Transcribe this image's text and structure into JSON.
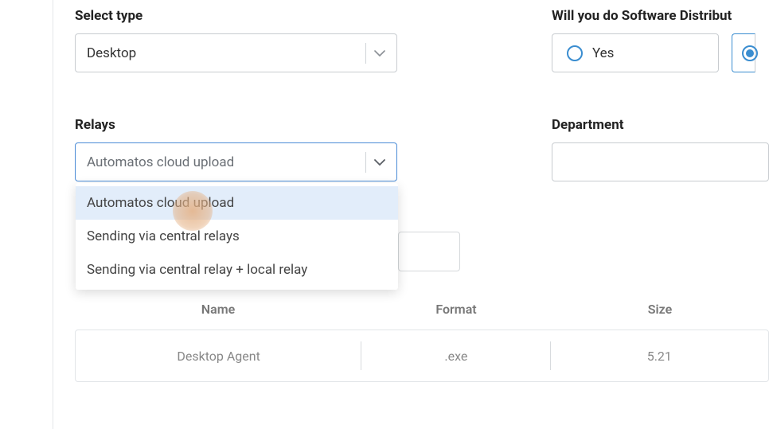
{
  "select_type": {
    "label": "Select type",
    "value": "Desktop"
  },
  "relays": {
    "label": "Relays",
    "value": "Automatos cloud upload",
    "options": [
      "Automatos cloud upload",
      "Sending via central relays",
      "Sending via central relay + local relay"
    ]
  },
  "distribution": {
    "label": "Will you do Software Distribut",
    "option_yes": "Yes"
  },
  "department": {
    "label": "Department"
  },
  "table": {
    "headers": {
      "name": "Name",
      "format": "Format",
      "size": "Size"
    },
    "rows": [
      {
        "name": "Desktop Agent",
        "format": ".exe",
        "size": "5.21"
      }
    ]
  }
}
